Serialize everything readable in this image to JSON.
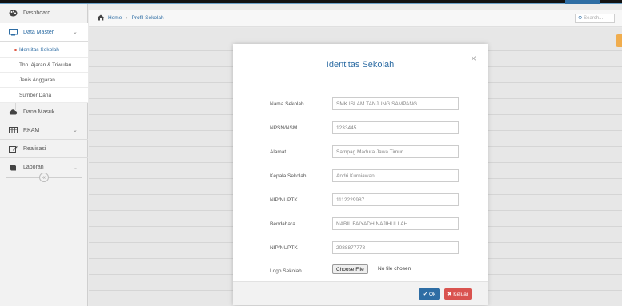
{
  "sidebar": {
    "dashboard": "Dashboard",
    "data_master": "Data Master",
    "sub_items": [
      "Identitas Sekolah",
      "Thn. Ajaran & Triwulan",
      "Jenis Anggaran",
      "Sumber Dana"
    ],
    "dana_masuk": "Dana Masuk",
    "rkam": "RKAM",
    "realisasi": "Realisasi",
    "laporan": "Laporan"
  },
  "breadcrumb": {
    "home": "Home",
    "current": "Profil Sekolah"
  },
  "search": {
    "placeholder": "Search..."
  },
  "modal": {
    "title": "Identitas Sekolah",
    "close": "×",
    "fields": [
      {
        "label": "Nama Sekolah",
        "value": "SMK ISLAM TANJUNG SAMPANG"
      },
      {
        "label": "NPSN/NSM",
        "value": "1233445"
      },
      {
        "label": "Alamat",
        "value": "Sampag Madura Jawa Timur"
      },
      {
        "label": "Kepala Sekolah",
        "value": "Andri Kurniawan"
      },
      {
        "label": "NIP/NUPTK",
        "value": "1112229987"
      },
      {
        "label": "Bendahara",
        "value": "NABIL FAIYADH NAJIHULLAH"
      },
      {
        "label": "NIP/NUPTK",
        "value": "2088877778"
      }
    ],
    "logo_label": "Logo Sekolah",
    "file_button": "Choose File",
    "file_note": "No file chosen",
    "ok_label": "✔ Ok",
    "exit_label": "✖ Keluar"
  },
  "colors": {
    "primary": "#2e6da4",
    "danger": "#d9534f",
    "warning": "#f0ad4e"
  }
}
